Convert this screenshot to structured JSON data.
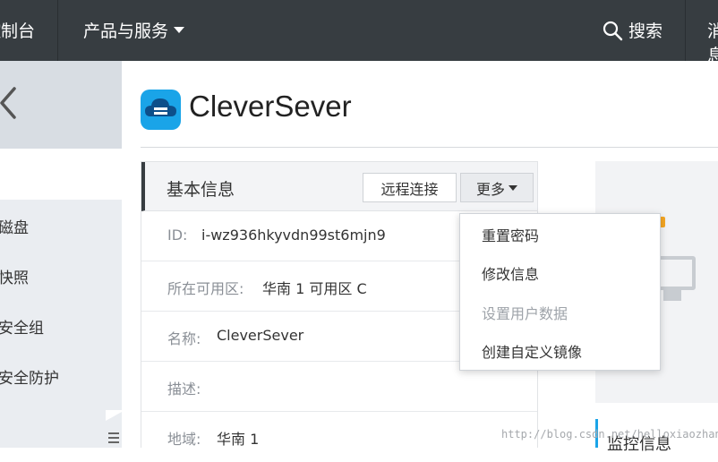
{
  "topbar": {
    "console_label": "控制台",
    "products_label": "产品与服务",
    "search_label": "搜索",
    "message_label": "消息"
  },
  "sidebar": {
    "items": [
      {
        "label": "磁盘"
      },
      {
        "label": "快照"
      },
      {
        "label": "安全组"
      },
      {
        "label": "安全防护"
      }
    ]
  },
  "app": {
    "title": "CleverSever"
  },
  "panel": {
    "title": "基本信息",
    "remote_button": "远程连接",
    "more_button": "更多",
    "rows": [
      {
        "label": "ID:",
        "value": "i-wz936hkyvdn99st6mjn9"
      },
      {
        "label": "所在可用区:",
        "value": "华南 1 可用区 C"
      },
      {
        "label": "名称:",
        "value": "CleverSever"
      },
      {
        "label": "描述:",
        "value": ""
      },
      {
        "label": "地域:",
        "value": "华南 1"
      }
    ]
  },
  "dropdown": {
    "items": [
      {
        "label": "重置密码",
        "disabled": false
      },
      {
        "label": "修改信息",
        "disabled": false
      },
      {
        "label": "设置用户数据",
        "disabled": true
      },
      {
        "label": "创建自定义镜像",
        "disabled": false
      }
    ]
  },
  "monitor": {
    "title": "监控信息"
  },
  "watermark": "http://blog.csdn.net/helloxiaozhanhuo"
}
